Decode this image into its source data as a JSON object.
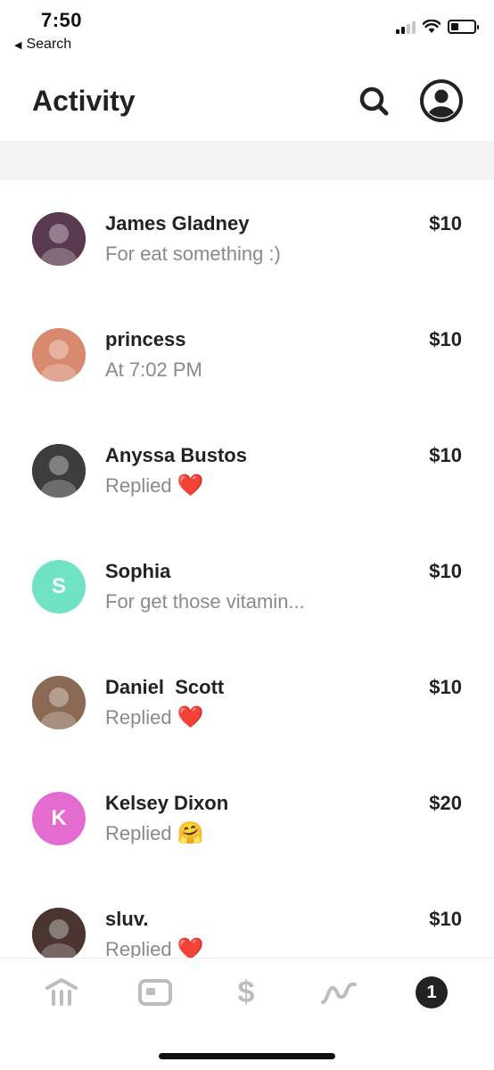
{
  "status_bar": {
    "time": "7:50",
    "back_label": "Search",
    "signal_bars_on": 2,
    "signal_bars_total": 4,
    "battery_level": 0.35
  },
  "header": {
    "title": "Activity",
    "search_icon": "search-icon",
    "profile_icon": "profile-icon"
  },
  "activity": [
    {
      "name": "James Gladney",
      "note": "For eat something :)",
      "emoji": "",
      "amount": "$10",
      "avatar_type": "photo",
      "avatar_color": "#5a3a50"
    },
    {
      "name": "princess",
      "note": "At 7:02 PM",
      "emoji": "",
      "amount": "$10",
      "avatar_type": "photo",
      "avatar_color": "#d98a6e"
    },
    {
      "name": "Anyssa Bustos",
      "note": "Replied",
      "emoji": "❤️",
      "amount": "$10",
      "avatar_type": "photo",
      "avatar_color": "#3d3d3d"
    },
    {
      "name": "Sophia",
      "note": "For get those vitamin...",
      "emoji": "",
      "amount": "$10",
      "avatar_type": "initial",
      "initial": "S",
      "avatar_color": "#6fe3c4"
    },
    {
      "name": "Daniel  Scott",
      "note": "Replied",
      "emoji": "❤️",
      "amount": "$10",
      "avatar_type": "photo",
      "avatar_color": "#8a6a55"
    },
    {
      "name": "Kelsey Dixon",
      "note": "Replied",
      "emoji": "🤗",
      "amount": "$20",
      "avatar_type": "initial",
      "initial": "K",
      "avatar_color": "#e46bd0"
    },
    {
      "name": "sluv.",
      "note": "Replied",
      "emoji": "❤️",
      "amount": "$10",
      "avatar_type": "photo",
      "avatar_color": "#4a3530"
    }
  ],
  "bottom_nav": {
    "items": [
      {
        "icon": "bank-icon"
      },
      {
        "icon": "card-icon"
      },
      {
        "icon": "dollar-icon",
        "glyph": "$"
      },
      {
        "icon": "investing-icon"
      },
      {
        "icon": "activity-badge-icon",
        "badge": "1"
      }
    ],
    "inactive_color": "#bdbdbd",
    "active_color": "#222222"
  }
}
